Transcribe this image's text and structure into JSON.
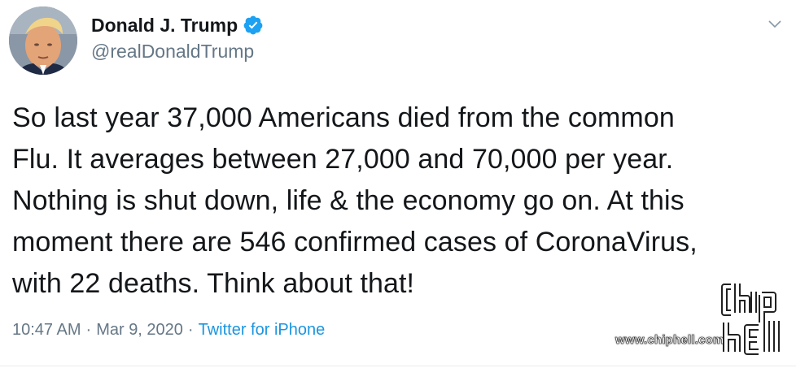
{
  "author": {
    "display_name": "Donald J. Trump",
    "handle": "@realDonaldTrump",
    "avatar_icon": "profile-photo",
    "verified_icon": "verified-badge-icon"
  },
  "tweet": {
    "lines": [
      "So last year 37,000 Americans died from the common",
      "Flu. It averages between 27,000 and 70,000 per year.",
      "Nothing is shut down, life & the economy go on. At this",
      "moment there are 546 confirmed cases of CoronaVirus,",
      "with 22 deaths. Think about that!"
    ]
  },
  "meta": {
    "time": "10:47 AM",
    "separator": "·",
    "date": "Mar 9, 2020",
    "separator2": "·",
    "source": "Twitter for iPhone"
  },
  "watermark": {
    "url": "www.chiphell.com"
  },
  "colors": {
    "link": "#1b95e0",
    "secondary_text": "#657786",
    "primary_text": "#14171a",
    "verified": "#1da1f2"
  }
}
